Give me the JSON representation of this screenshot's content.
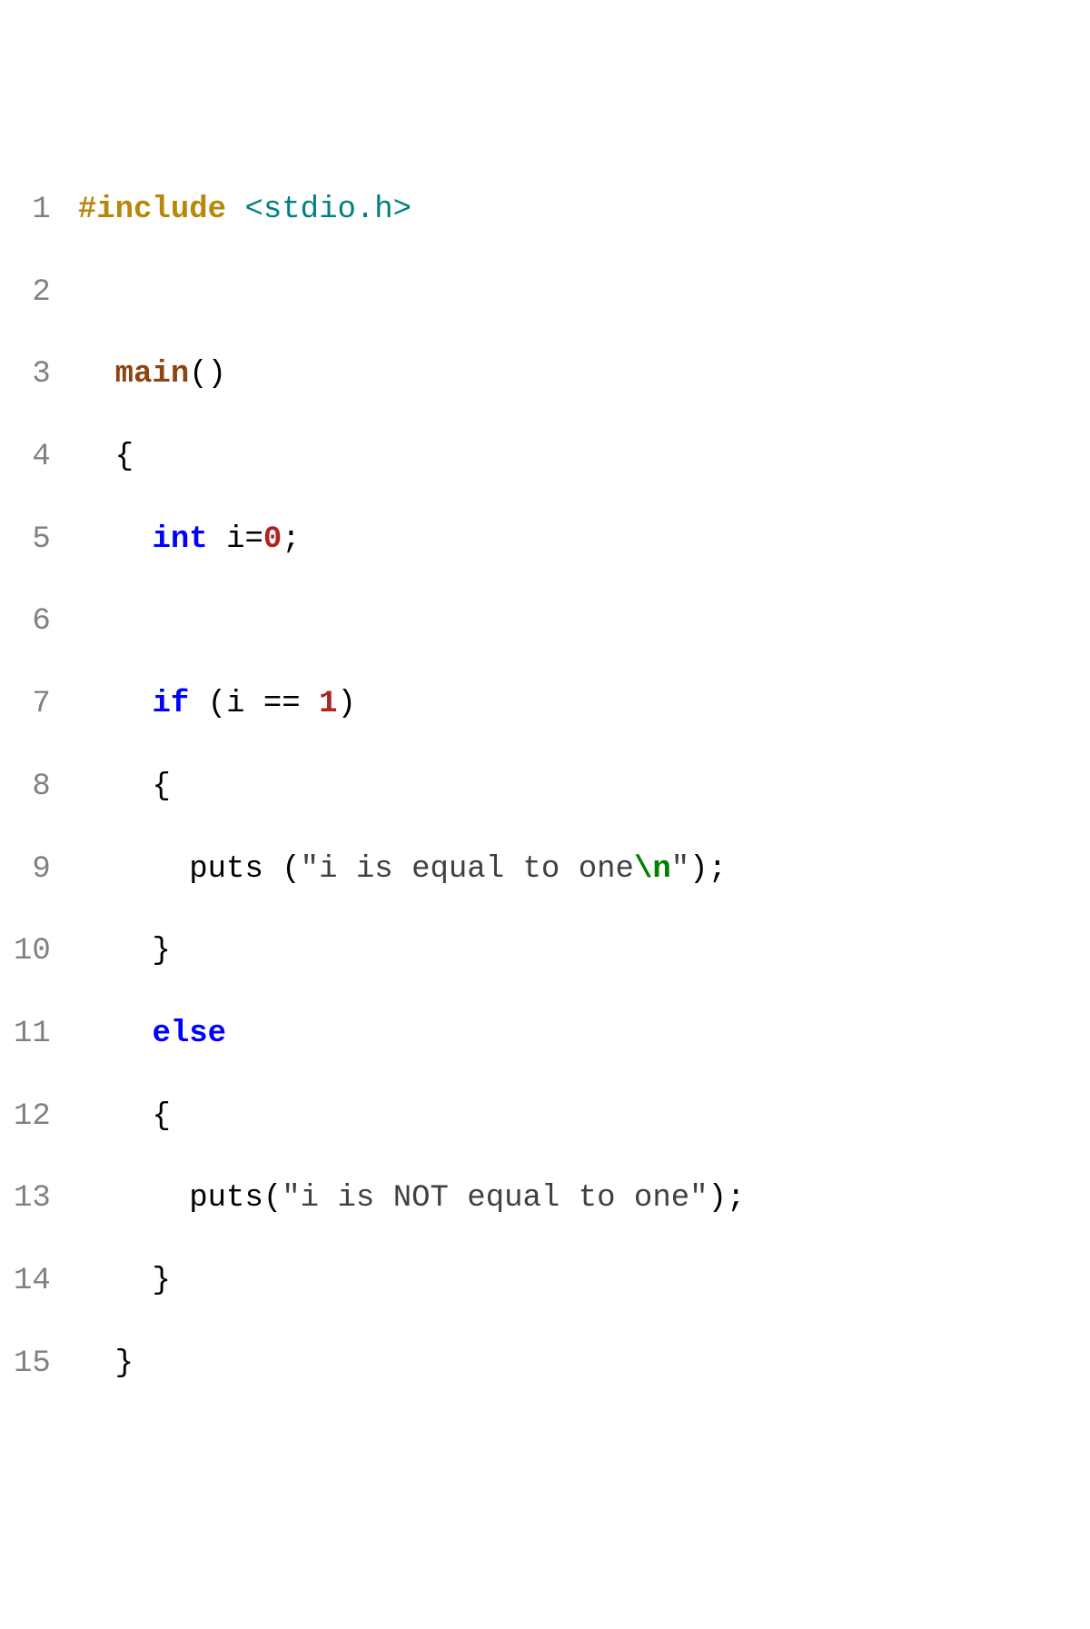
{
  "editor": {
    "lineNumbers": [
      "1",
      "2",
      "3",
      "4",
      "5",
      "6",
      "7",
      "8",
      "9",
      "10",
      "11",
      "12",
      "13",
      "14",
      "15"
    ],
    "lines": {
      "l1": {
        "preproc": "#include",
        "sp": " ",
        "header": "<stdio.h>"
      },
      "l2": {
        "blank": ""
      },
      "l3": {
        "indent": "  ",
        "fn": "main",
        "parens": "()"
      },
      "l4": {
        "indent": "  ",
        "brace": "{"
      },
      "l5": {
        "indent": "    ",
        "type": "int",
        "sp1": " ",
        "ident": "i",
        "eq": "=",
        "num": "0",
        "semi": ";"
      },
      "l6": {
        "blank": ""
      },
      "l7": {
        "indent": "    ",
        "kw": "if",
        "sp1": " ",
        "lp": "(",
        "ident": "i",
        "sp2": " ",
        "op": "==",
        "sp3": " ",
        "num": "1",
        "rp": ")"
      },
      "l8": {
        "indent": "    ",
        "brace": "{"
      },
      "l9": {
        "indent": "      ",
        "fn": "puts",
        "sp1": " ",
        "lp": "(",
        "q1": "\"",
        "str": "i is equal to one",
        "esc": "\\n",
        "q2": "\"",
        "rp": ")",
        "semi": ";"
      },
      "l10": {
        "indent": "    ",
        "brace": "}"
      },
      "l11": {
        "indent": "    ",
        "kw": "else"
      },
      "l12": {
        "indent": "    ",
        "brace": "{"
      },
      "l13": {
        "indent": "      ",
        "fn": "puts",
        "lp": "(",
        "q1": "\"",
        "str": "i is NOT equal to one",
        "q2": "\"",
        "rp": ")",
        "semi": ";"
      },
      "l14": {
        "indent": "    ",
        "brace": "}"
      },
      "l15": {
        "indent": "  ",
        "brace": "}"
      }
    }
  }
}
